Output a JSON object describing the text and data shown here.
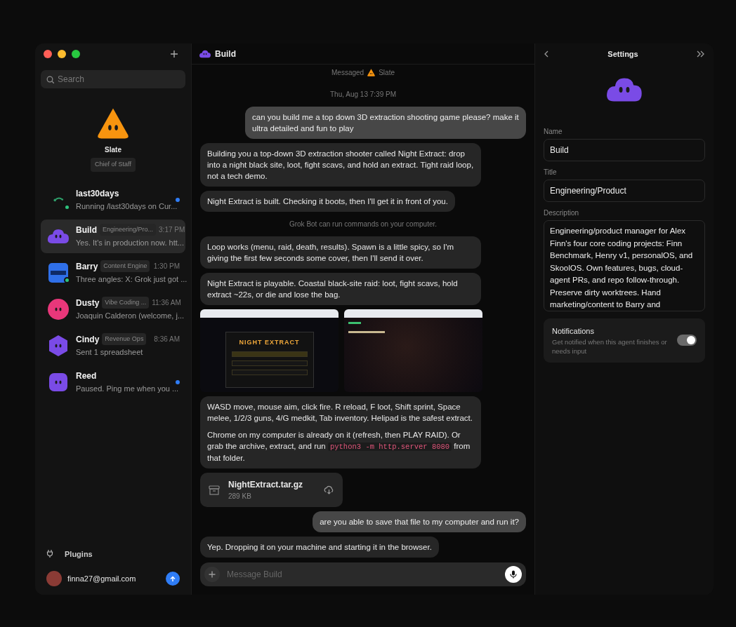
{
  "window": {
    "controls": [
      {
        "color": "#ff5f57"
      },
      {
        "color": "#febc2e"
      },
      {
        "color": "#28c840"
      }
    ]
  },
  "sidebar": {
    "search": {
      "placeholder": "Search"
    },
    "featured": {
      "name": "Slate",
      "role": "Chief of Staff",
      "avatar": {
        "kind": "triangle",
        "color": "#f7940f"
      }
    },
    "conversations": [
      {
        "name": "last30days",
        "preview": "Running /last30days on Cur...",
        "selected": false,
        "online": true,
        "unread": true,
        "avatar": {
          "kind": "sprout",
          "color": "#2e9e6a"
        }
      },
      {
        "name": "Build",
        "tag": "Engineering/Pro...",
        "time": "3:17 PM",
        "preview": "Yes. It's in production now. htt...",
        "selected": true,
        "online": false,
        "unread": false,
        "avatar": {
          "kind": "cloud",
          "color": "#7a4be6"
        }
      },
      {
        "name": "Barry",
        "tag": "Content Engine",
        "time": "1:30 PM",
        "preview": "Three angles: X: Grok just got ...",
        "selected": false,
        "online": true,
        "unread": false,
        "avatar": {
          "kind": "square",
          "color": "#2f6fe8"
        }
      },
      {
        "name": "Dusty",
        "tag": "Vibe Coding ...",
        "time": "11:36 AM",
        "preview": "Joaquin Calderon (welcome, j...",
        "selected": false,
        "online": false,
        "unread": false,
        "avatar": {
          "kind": "circle",
          "color": "#e8377a"
        }
      },
      {
        "name": "Cindy",
        "tag": "Revenue Ops",
        "time": "8:36 AM",
        "preview": "Sent 1 spreadsheet",
        "selected": false,
        "online": false,
        "unread": false,
        "avatar": {
          "kind": "hexagon",
          "color": "#7a4be6"
        }
      },
      {
        "name": "Reed",
        "preview": "Paused. Ping me when you ...",
        "selected": false,
        "online": false,
        "unread": true,
        "avatar": {
          "kind": "rounded",
          "color": "#7a4be6"
        }
      }
    ],
    "plugins": "Plugins",
    "account": {
      "email": "finna27@gmail.com"
    }
  },
  "chat": {
    "title": "Build",
    "avatar": {
      "kind": "cloud",
      "color": "#7a4be6"
    },
    "messages": [
      {
        "kind": "notice",
        "text": "Messaged",
        "agent": "Slate",
        "avatar": {
          "kind": "triangle",
          "color": "#f7940f"
        }
      },
      {
        "kind": "timestamp",
        "text": "Thu, Aug 13 7:39 PM"
      },
      {
        "kind": "user",
        "text": "can you build me a top down 3D extraction shooting game please? make it ultra detailed and fun to play"
      },
      {
        "kind": "bot",
        "paragraphs": [
          [
            {
              "kind": "text",
              "text": "Building you a top-down 3D extraction shooter called Night Extract: drop into a night black site, loot, fight scavs, and hold an extract. Tight raid loop, not a tech demo."
            }
          ]
        ]
      },
      {
        "kind": "bot",
        "paragraphs": [
          [
            {
              "kind": "text",
              "text": "Night Extract is built. Checking it boots, then I'll get it in front of you."
            }
          ]
        ]
      },
      {
        "kind": "system",
        "text": "Grok Bot can run commands on your computer."
      },
      {
        "kind": "bot",
        "paragraphs": [
          [
            {
              "kind": "text",
              "text": "Loop works (menu, raid, death, results). Spawn is a little spicy, so I'm giving the first few seconds some cover, then I'll send it over."
            }
          ]
        ]
      },
      {
        "kind": "bot",
        "paragraphs": [
          [
            {
              "kind": "text",
              "text": "Night Extract is playable. Coastal black-site raid: loot, fight scavs, hold extract ~22s, or die and lose the bag."
            }
          ]
        ]
      },
      {
        "kind": "images",
        "images": [
          {
            "kind": "menu",
            "title": "NIGHT EXTRACT"
          },
          {
            "kind": "gameplay"
          }
        ]
      },
      {
        "kind": "bot",
        "paragraphs": [
          [
            {
              "kind": "text",
              "text": "WASD move, mouse aim, click fire. R reload, F loot, Shift sprint, Space melee, 1/2/3 guns, 4/G medkit, Tab inventory. Helipad is the safest extract."
            }
          ],
          [
            {
              "kind": "text",
              "text": "Chrome on my computer is already on it (refresh, then PLAY RAID). Or grab the archive, extract, and run "
            },
            {
              "kind": "code",
              "text": "python3 -m http.server 8080"
            },
            {
              "kind": "text",
              "text": " from that folder."
            }
          ]
        ]
      },
      {
        "kind": "file",
        "name": "NightExtract.tar.gz",
        "size": "289 KB"
      },
      {
        "kind": "user",
        "text": "are you able to save that file to my computer and run it?"
      },
      {
        "kind": "bot",
        "paragraphs": [
          [
            {
              "kind": "text",
              "text": "Yep. Dropping it on your machine and starting it in the browser."
            }
          ]
        ]
      }
    ],
    "composer": {
      "placeholder": "Message Build"
    }
  },
  "settings": {
    "title": "Settings",
    "avatar": {
      "kind": "cloud",
      "color": "#7a4be6"
    },
    "fields": [
      {
        "kind": "input",
        "label": "Name",
        "value": "Build"
      },
      {
        "kind": "input",
        "label": "Title",
        "value": "Engineering/Product"
      },
      {
        "kind": "textarea",
        "label": "Description",
        "value": "Engineering/product manager for Alex Finn's four core coding projects: Finn Benchmark, Henry v1, personalOS, and SkoolOS. Own features, bugs, cloud-agent PRs, and repo follow-through. Preserve dirty worktrees. Hand marketing/content to Barry and"
      }
    ],
    "notifications": {
      "title": "Notifications",
      "description": "Get notified when this agent finishes or needs input",
      "on": true
    }
  }
}
